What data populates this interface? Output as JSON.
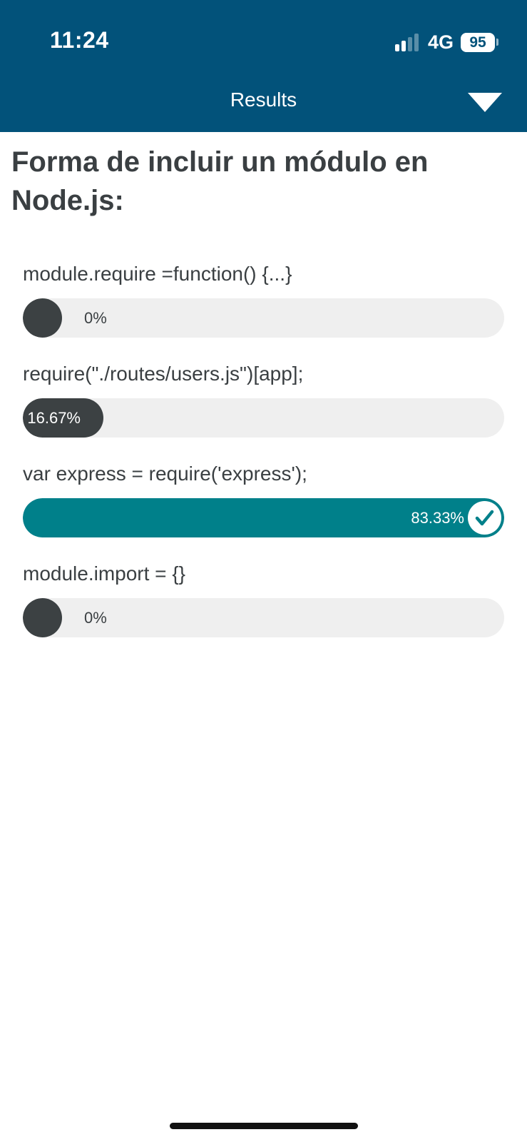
{
  "status_bar": {
    "time": "11:24",
    "network": "4G",
    "battery": "95",
    "signal_bars_active": 2,
    "signal_bars_total": 4
  },
  "header": {
    "title": "Results",
    "menu_icon": "caret-down-icon"
  },
  "question": "Forma de incluir un módulo en Node.js:",
  "options": [
    {
      "label": "module.require =function() {...}",
      "percent_text": "0%",
      "fraction": 0,
      "correct": false
    },
    {
      "label": "require(\"./routes/users.js\")[app];",
      "percent_text": "16.67%",
      "fraction": 0.1667,
      "correct": false
    },
    {
      "label": "var express = require('express');",
      "percent_text": "83.33%",
      "fraction": 0.8333,
      "correct": true
    },
    {
      "label": "module.import = {}",
      "percent_text": "0%",
      "fraction": 0,
      "correct": false
    }
  ],
  "colors": {
    "header_bg": "#02527a",
    "bar_track": "#efefef",
    "bar_fill": "#3c4143",
    "correct_fill": "#00808a",
    "text": "#3a3f42"
  }
}
